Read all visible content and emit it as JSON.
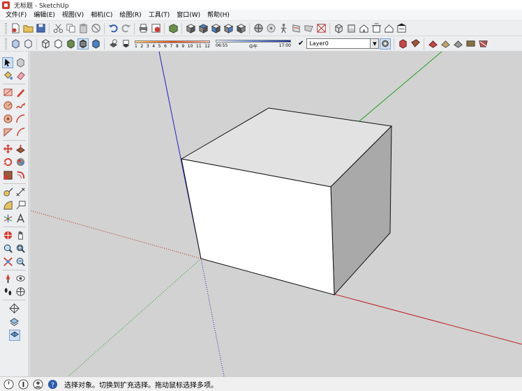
{
  "window": {
    "title": "无标题 - SketchUp"
  },
  "menu": [
    "文件(F)",
    "编辑(E)",
    "视图(V)",
    "相机(C)",
    "绘图(R)",
    "工具(T)",
    "窗口(W)",
    "帮助(H)"
  ],
  "shadow": {
    "months": [
      "1",
      "2",
      "3",
      "4",
      "5",
      "6",
      "7",
      "8",
      "9",
      "10",
      "11",
      "12"
    ],
    "time_start": "06:55",
    "time_mid": "中午",
    "time_end": "17:00"
  },
  "layer": {
    "current": "Layer0"
  },
  "status": {
    "message": "选择对象。切换到扩充选择。拖动鼠标选择多项。"
  },
  "colors": {
    "canvas": "#d2d2d2",
    "axis_red": "#c02020",
    "axis_green": "#20a020",
    "axis_blue": "#2020c0",
    "face_front": "#ffffff",
    "face_top": "#e2e2e2",
    "face_side": "#a9a9a9"
  }
}
